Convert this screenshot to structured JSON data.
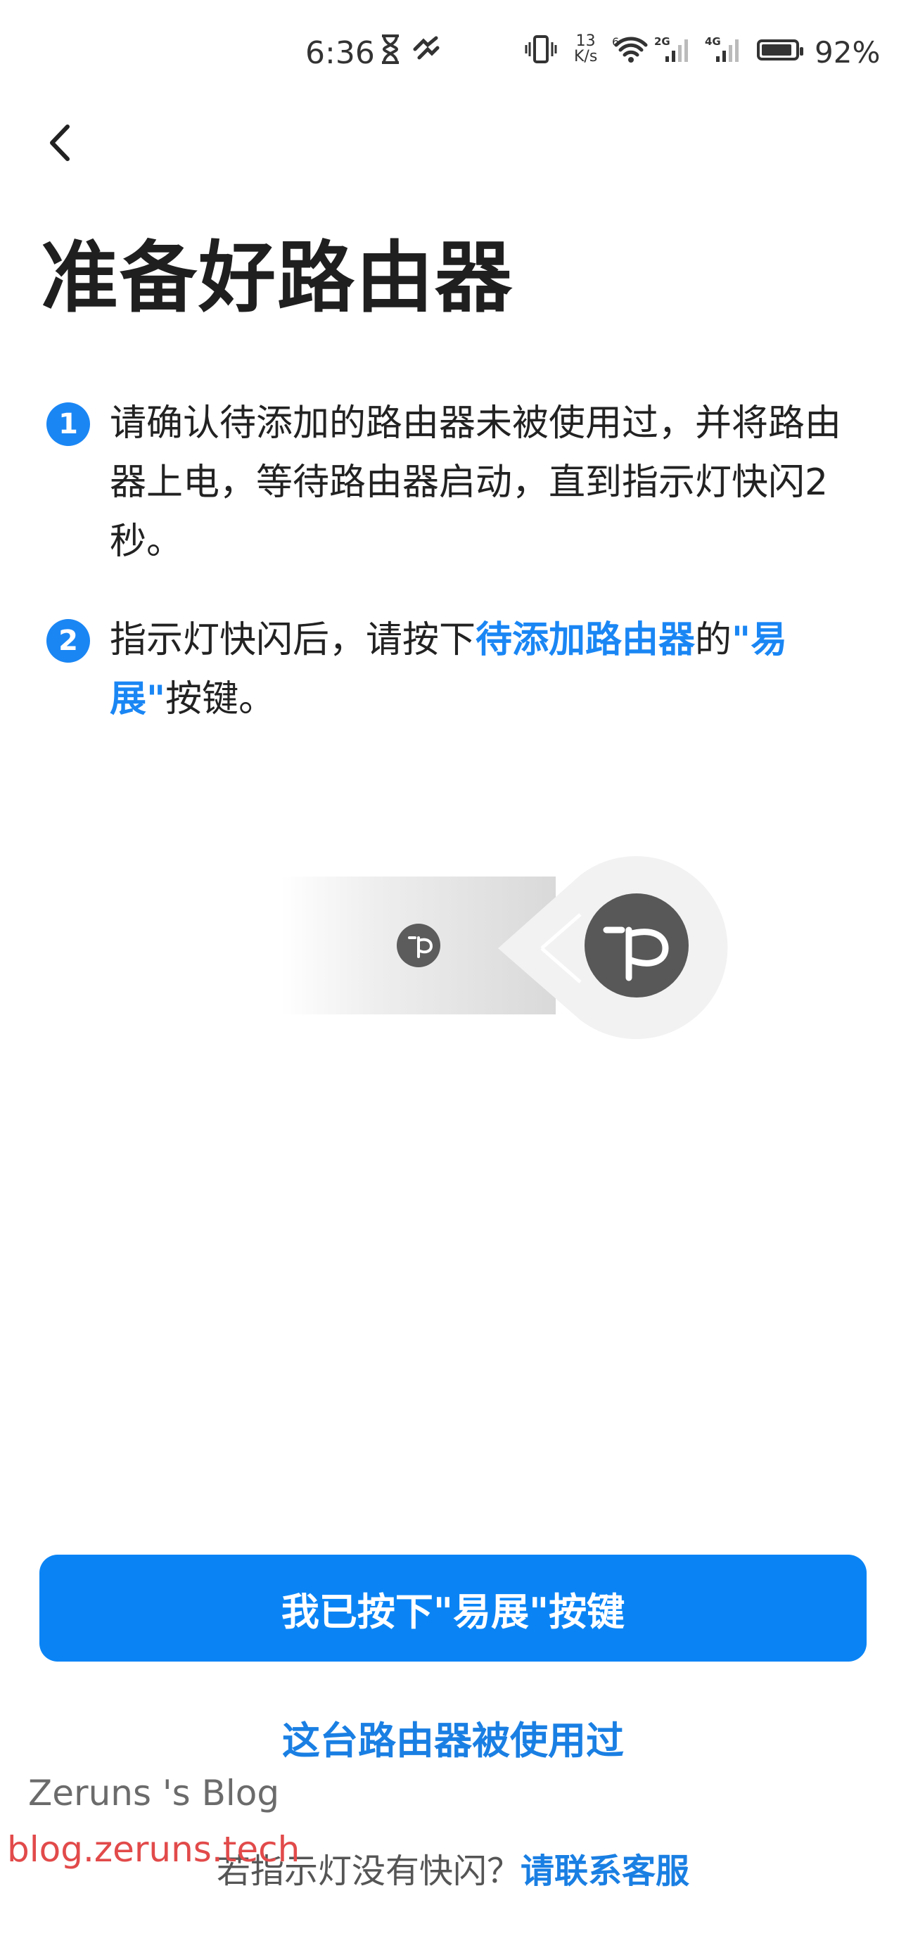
{
  "status_bar": {
    "time": "6:36",
    "net_speed_value": "13",
    "net_speed_unit": "K/s",
    "signal_1_label": "2G",
    "signal_2_label": "4G",
    "wifi_label": "6",
    "battery_level": 0.92,
    "battery_percent": "92%"
  },
  "header": {
    "title": "准备好路由器"
  },
  "steps": [
    {
      "number": "1",
      "text": "请确认待添加的路由器未被使用过，并将路由器上电，等待路由器启动，直到指示灯快闪2秒。"
    },
    {
      "number": "2",
      "text_before": "指示灯快闪后，请按下",
      "highlight_1": "待添加路由器",
      "text_middle": "的",
      "highlight_2": "\"易展\"",
      "text_after": "按键。"
    }
  ],
  "actions": {
    "primary_button": "我已按下\"易展\"按键",
    "secondary_link": "这台路由器被使用过",
    "footer_question": "若指示灯没有快闪？",
    "footer_link": "请联系客服"
  },
  "watermark": {
    "name": "Zeruns 's Blog",
    "url": "blog.zeruns.tech"
  },
  "colors": {
    "accent": "#0a84f5",
    "link": "#1a7fe3",
    "watermark_url": "#e24a4a"
  }
}
